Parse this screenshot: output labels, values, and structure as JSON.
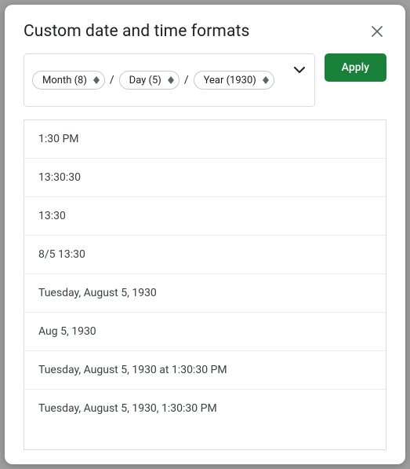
{
  "dialog": {
    "title": "Custom date and time formats"
  },
  "controls": {
    "apply_label": "Apply"
  },
  "format": {
    "chips": [
      {
        "label": "Month (8)"
      },
      {
        "label": "Day (5)"
      },
      {
        "label": "Year (1930)"
      }
    ],
    "separators": [
      "/",
      "/"
    ]
  },
  "examples": [
    "1:30 PM",
    "13:30:30",
    "13:30",
    "8/5 13:30",
    "Tuesday, August 5, 1930",
    "Aug 5, 1930",
    "Tuesday, August 5, 1930 at 1:30:30 PM",
    "Tuesday, August 5, 1930, 1:30:30 PM"
  ]
}
